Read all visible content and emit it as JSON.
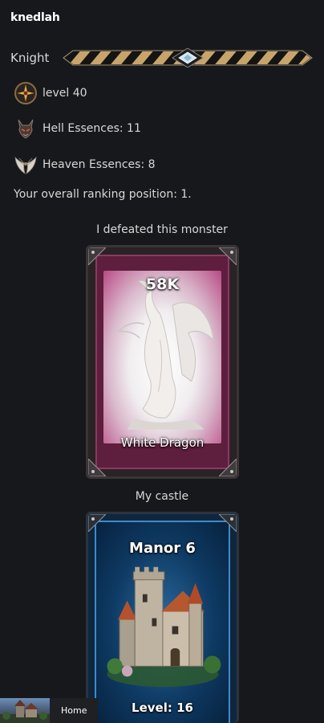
{
  "player": {
    "username": "knedlah",
    "class_name": "Knight",
    "level_text": "level 40",
    "hell_essences_text": "Hell Essences: 11",
    "heaven_essences_text": "Heaven Essences: 8",
    "ranking_text": "Your overall ranking position: 1."
  },
  "icons": {
    "level": "compass-star-icon",
    "hell": "demon-head-icon",
    "heaven": "angel-wings-icon",
    "rank": "rank-bar-diamond-icon"
  },
  "monster_section": {
    "caption": "I defeated this monster",
    "card": {
      "value": "58K",
      "name": "White Dragon"
    }
  },
  "castle_section": {
    "caption": "My castle",
    "card": {
      "title": "Manor 6",
      "level_text": "Level: 16"
    }
  },
  "nav": {
    "home_label": "Home"
  },
  "colors": {
    "background": "#17181b",
    "text": "#d8d8d8",
    "monster_frame": "#b24c85",
    "castle_frame": "#3c8bd0",
    "rank_gold": "#c8a46a"
  }
}
